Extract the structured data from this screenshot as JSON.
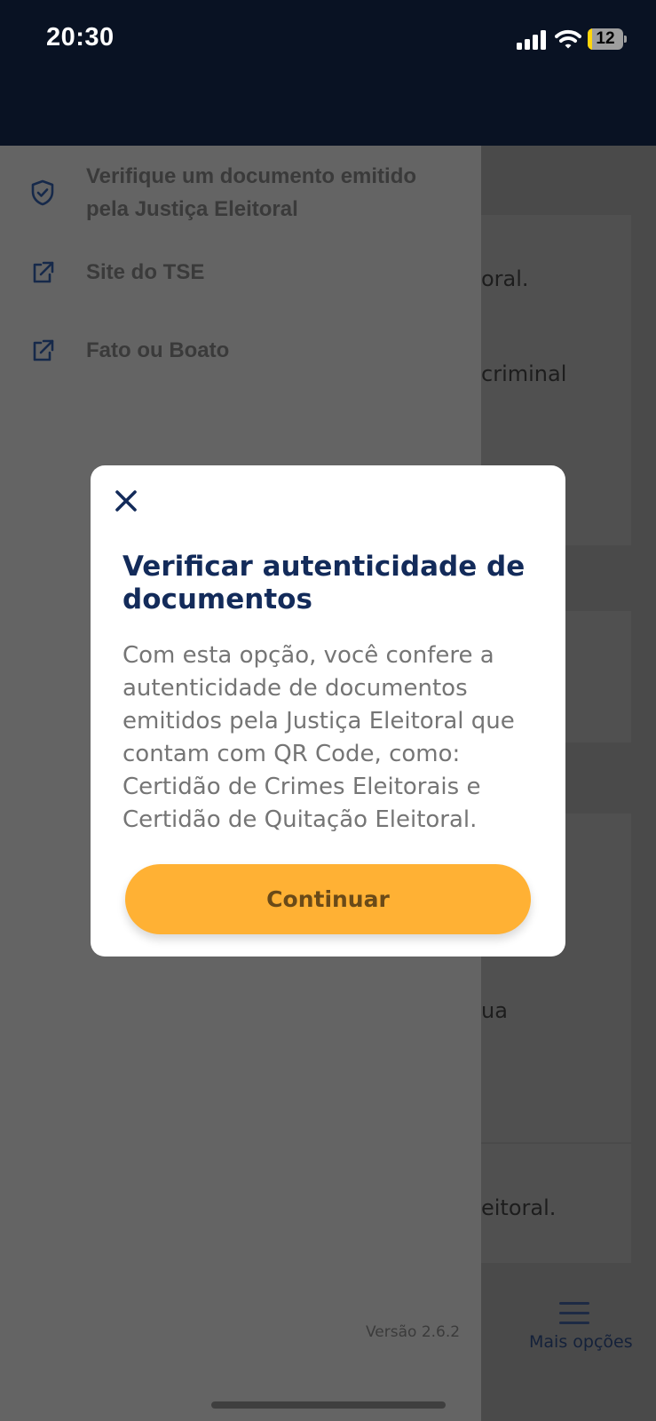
{
  "status_bar": {
    "time": "20:30",
    "battery_level": "12",
    "battery_fraction": 0.12,
    "icons": [
      "signal-icon",
      "wifi-icon",
      "battery-icon"
    ]
  },
  "drawer": {
    "items": [
      {
        "label": "Verifique um documento emitido pela Justiça Eleitoral",
        "icon": "shield-check-icon"
      },
      {
        "label": "Site do TSE",
        "icon": "external-link-icon"
      },
      {
        "label": "Fato ou Boato",
        "icon": "external-link-icon"
      }
    ],
    "version": "Versão 2.6.2"
  },
  "background_page": {
    "text_fragments": [
      "oral.",
      "criminal",
      "ua",
      "eitoral."
    ],
    "bottom_nav": {
      "label": "Mais opções",
      "icon": "menu-icon"
    }
  },
  "modal": {
    "close_icon": "close-icon",
    "title": "Verificar autenticidade de documentos",
    "body": "Com esta opção, você confere a autenticidade de documentos emitidos pela Justiça Eleitoral que contam com QR Code, como: Certidão de Crimes Eleitorais e Certidão de Quitação Eleitoral.",
    "button_label": "Continuar"
  },
  "colors": {
    "header_bg": "#091223",
    "title": "#132b5a",
    "button_bg": "#ffb134",
    "battery": "#ffd60a"
  }
}
